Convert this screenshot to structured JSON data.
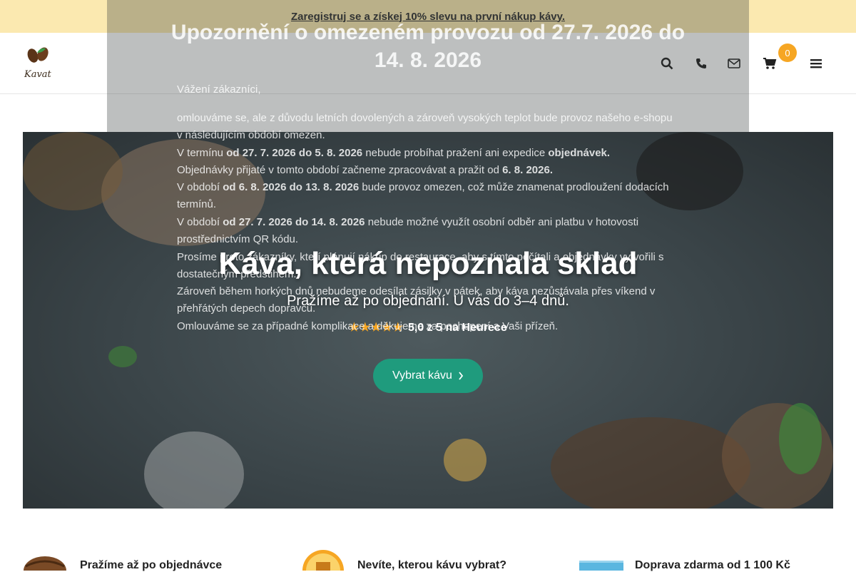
{
  "topbar": {
    "promo": "Zaregistruj se a získej 10% slevu na první nákup kávy."
  },
  "header": {
    "logo_text": "Kavat",
    "cart_count": "0"
  },
  "notice": {
    "title": "Upozornění o omezeném provozu od 27.7. 2026 do 14. 8. 2026",
    "greeting": "Vážení zákazníci,",
    "p1": "omlouváme se, ale z důvodu letních dovolených a zároveň vysokých teplot bude provoz našeho e-shopu v následujícím období omezen.",
    "p2_prefix": "V termínu",
    "p2_bold1": "od 27. 7. 2026 do 5. 8. 2026",
    "p2_mid": "nebude probíhat pražení ani expedice",
    "p2_bold2": "objednávek.",
    "p3_prefix": "Objednávky přijaté v tomto období začneme zpracovávat a pražit od",
    "p3_bold": "6. 8. 2026.",
    "p4_prefix": "V období",
    "p4_bold": "od 6. 8. 2026 do 13. 8. 2026",
    "p4_rest": "bude provoz omezen, což může znamenat prodloužení dodacích termínů.",
    "p5_prefix": "V období",
    "p5_bold": "od 27. 7. 2026 do 14. 8. 2026",
    "p5_rest": "nebude možné využít osobní odběr ani platbu v hotovosti prostřednictvím QR kódu.",
    "p6": "Prosíme proto zákazníky, kteří plánují nákup do restaurace, aby s tímto počítali a objednávky vytvořili s dostatečným předstihem.",
    "p7": "Zároveň během horkých dnů nebudeme odesílat zásilky v pátek, aby káva nezůstávala přes víkend v přehřátých depech dopravců.",
    "p8": "Omlouváme se za případné komplikace a děkujeme za pochopení a Vaši přízeň."
  },
  "hero": {
    "title": "Káva, která nepoznala sklad",
    "subtitle": "Pražíme až po objednání. U vás do 3–4 dnů.",
    "stars": "★★★★★",
    "rating": "5,0 z 5 na Heurece",
    "button": "Vybrat kávu"
  },
  "features": [
    {
      "title": "Pražíme až po objednávce",
      "icon": "coffee-bean-icon"
    },
    {
      "title": "Nevíte, kterou kávu vybrat?",
      "icon": "coffee-cup-icon"
    },
    {
      "title": "Doprava zdarma od 1 100 Kč",
      "icon": "delivery-truck-icon"
    }
  ],
  "colors": {
    "accent": "#1f9b7d",
    "badge": "#f6a623",
    "topbar": "#fbe9b0"
  }
}
